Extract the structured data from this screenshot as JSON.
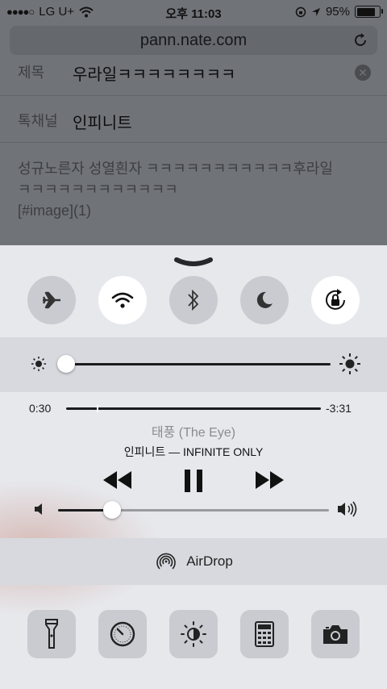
{
  "status_bar": {
    "carrier": "LG U+",
    "time": "오후 11:03",
    "battery_percent": "95%",
    "battery_level": 0.95
  },
  "browser": {
    "url": "pann.nate.com"
  },
  "form": {
    "title_label": "제목",
    "title_value": "우라일ㅋㅋㅋㅋㅋㅋㅋㅋ",
    "channel_label": "톡채널",
    "channel_value": "인피니트",
    "body_line1": "성규노른자 성열흰자 ㅋㅋㅋㅋㅋㅋㅋㅋㅋㅋㅋ후라일",
    "body_line2": "ㅋㅋㅋㅋㅋㅋㅋㅋㅋㅋㅋㅋ",
    "body_line3": "[#image](1)"
  },
  "control_center": {
    "toggles": [
      {
        "name": "airplane-icon",
        "on": false
      },
      {
        "name": "wifi-icon",
        "on": true
      },
      {
        "name": "bluetooth-icon",
        "on": false
      },
      {
        "name": "do-not-disturb-icon",
        "on": false
      },
      {
        "name": "rotation-lock-icon",
        "on": true
      }
    ],
    "brightness_level": 0.03,
    "music": {
      "elapsed": "0:30",
      "remaining": "-3:31",
      "progress": 0.12,
      "song": "태풍 (The Eye)",
      "artist_album": "인피니트 — INFINITE ONLY",
      "volume_level": 0.2
    },
    "airdrop_label": "AirDrop",
    "tools": [
      "flashlight-icon",
      "timer-icon",
      "night-shift-icon",
      "calculator-icon",
      "camera-icon"
    ]
  }
}
